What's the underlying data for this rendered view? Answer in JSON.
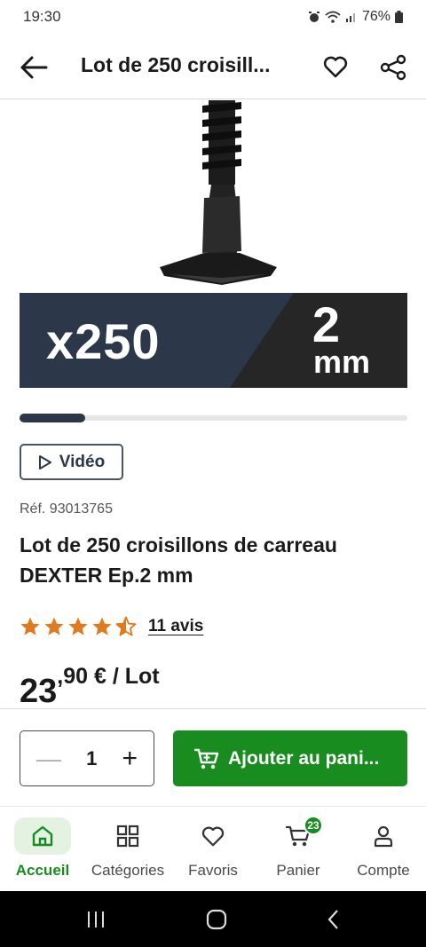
{
  "status_bar": {
    "time": "19:30",
    "battery": "76%"
  },
  "app_bar": {
    "title": "Lot de 250 croisill..."
  },
  "hero": {
    "banner_quantity": "x250",
    "banner_size_number": "2",
    "banner_size_unit": "mm",
    "carousel_progress": 0.17
  },
  "video_button": {
    "label": "Vidéo"
  },
  "product": {
    "reference": "Réf. 93013765",
    "title": "Lot de 250 croisillons de carreau DEXTER Ep.2 mm",
    "rating": 4.5,
    "reviews_label": "11 avis",
    "price_integer": "23",
    "price_decimal": ",90 € / Lot"
  },
  "buy_bar": {
    "quantity": "1",
    "add_to_cart_label": "Ajouter au pani..."
  },
  "bottom_nav": {
    "items": [
      {
        "label": "Accueil",
        "icon": "home-icon",
        "active": true
      },
      {
        "label": "Catégories",
        "icon": "grid-icon",
        "active": false
      },
      {
        "label": "Favoris",
        "icon": "heart-icon",
        "active": false
      },
      {
        "label": "Panier",
        "icon": "cart-icon",
        "active": false,
        "badge": "23"
      },
      {
        "label": "Compte",
        "icon": "user-icon",
        "active": false
      }
    ]
  },
  "colors": {
    "brand_green": "#188c1f",
    "banner_navy": "#2c3749",
    "star_orange": "#e07a1f"
  }
}
